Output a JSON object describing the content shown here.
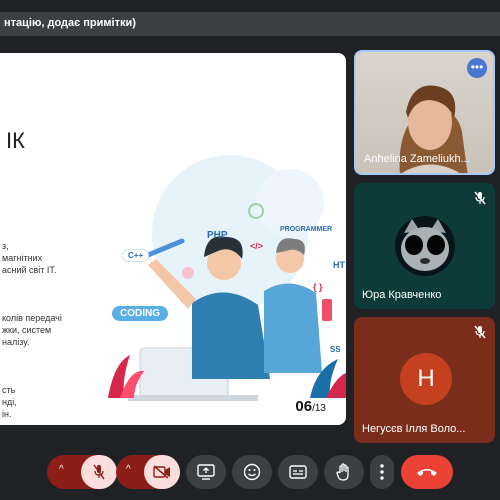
{
  "header": {
    "title": "нтацію, додає примітки)"
  },
  "slide": {
    "heading": "ІК",
    "lines_1": [
      "з,",
      "магнітних",
      "асний світ IT."
    ],
    "lines_2": [
      "колів передачі",
      "жки, систем",
      "налізу."
    ],
    "lines_3": [
      "сть",
      "нді,",
      "ін."
    ],
    "tags": {
      "php": "PHP",
      "programmer": "PROGRAMMER",
      "cpp": "C++",
      "coding": "CODING",
      "html_code": "</>",
      "ht": "HT",
      "braces": "{ }",
      "ss": "SS"
    },
    "page_current": "06",
    "page_total": "/13"
  },
  "participants": [
    {
      "name": "Anhelina Zameliukh...",
      "more_label": "•••"
    },
    {
      "name": "Юра Кравченко"
    },
    {
      "name": "Негусєв Ілля Воло...",
      "initial": "H"
    }
  ],
  "controls": {
    "mic_caret": "^",
    "cam_caret": "^"
  },
  "colors": {
    "background": "#202124",
    "control_dark": "#3c4043",
    "control_muted": "#8c1d18",
    "end_call": "#ea4335",
    "accent_blue": "#4a78d0"
  }
}
